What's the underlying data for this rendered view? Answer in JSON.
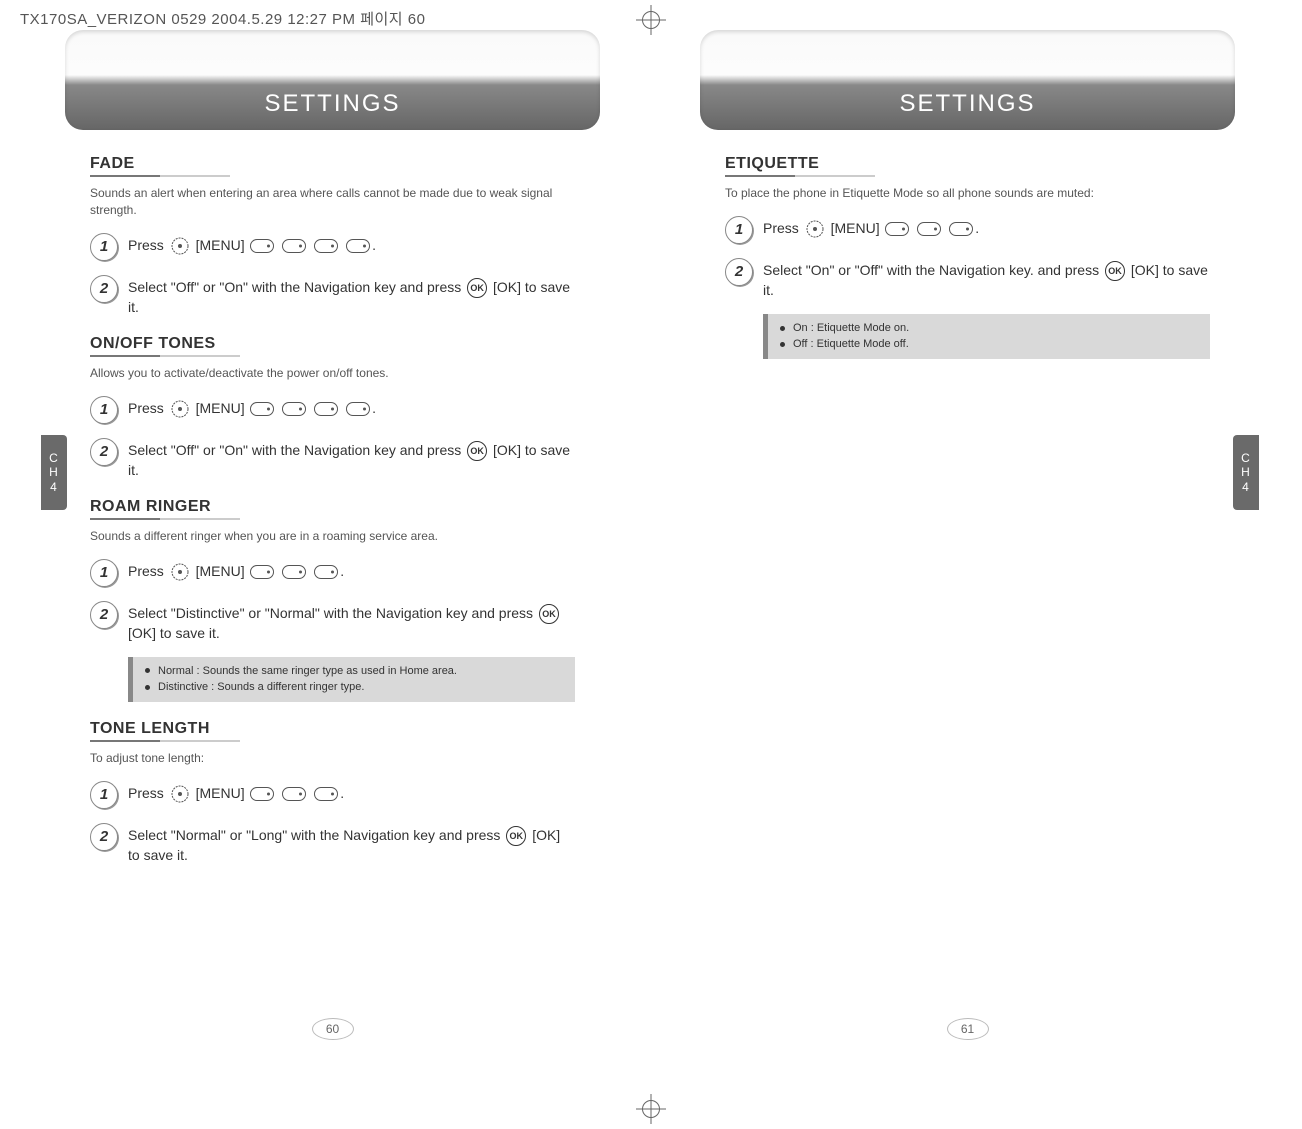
{
  "meta": {
    "header_text": "TX170SA_VERIZON 0529  2004.5.29 12:27 PM  페이지 60"
  },
  "chapter_tab": {
    "line1": "C",
    "line2": "H",
    "num": "4"
  },
  "left_page": {
    "title": "SETTINGS",
    "page_number": "60",
    "sections": {
      "fade": {
        "heading": "FADE",
        "desc": "Sounds an alert when entering an area where calls cannot be made due to weak signal strength.",
        "step1_pre": "Press ",
        "step1_menu": " [MENU] ",
        "step2": "Select \"Off\" or \"On\" with the Navigation key and press ",
        "step2_tail": " [OK] to save it."
      },
      "onoff": {
        "heading": "ON/OFF TONES",
        "desc": "Allows you to activate/deactivate the power on/off tones.",
        "step1_pre": "Press ",
        "step1_menu": " [MENU] ",
        "step2": "Select \"Off\" or \"On\" with the Navigation key and press ",
        "step2_tail": " [OK] to save it."
      },
      "roam": {
        "heading": "ROAM RINGER",
        "desc": "Sounds a different ringer when you are in a roaming service area.",
        "step1_pre": "Press ",
        "step1_menu": " [MENU] ",
        "step2": "Select \"Distinctive\" or \"Normal\" with the Navigation key and press ",
        "step2_tail": " [OK] to save it.",
        "note_a": "Normal : Sounds the same ringer type as used in Home area.",
        "note_b": "Distinctive : Sounds a different ringer type."
      },
      "tone": {
        "heading": "TONE LENGTH",
        "desc": "To adjust tone length:",
        "step1_pre": "Press ",
        "step1_menu": " [MENU] ",
        "step2": "Select \"Normal\" or \"Long\" with the Navigation key and press ",
        "step2_tail": " [OK] to save it."
      }
    }
  },
  "right_page": {
    "title": "SETTINGS",
    "page_number": "61",
    "sections": {
      "etiquette": {
        "heading": "ETIQUETTE",
        "desc": "To place the phone in Etiquette Mode so all phone sounds are muted:",
        "step1_pre": "Press ",
        "step1_menu": " [MENU] ",
        "step2": "Select \"On\" or \"Off\" with the Navigation key. and press ",
        "step2_tail": " [OK] to save it.",
        "note_a": "On : Etiquette Mode on.",
        "note_b": "Off : Etiquette Mode off."
      }
    }
  },
  "nums": {
    "one": "1",
    "two": "2"
  },
  "icons": {
    "ok": "OK"
  }
}
